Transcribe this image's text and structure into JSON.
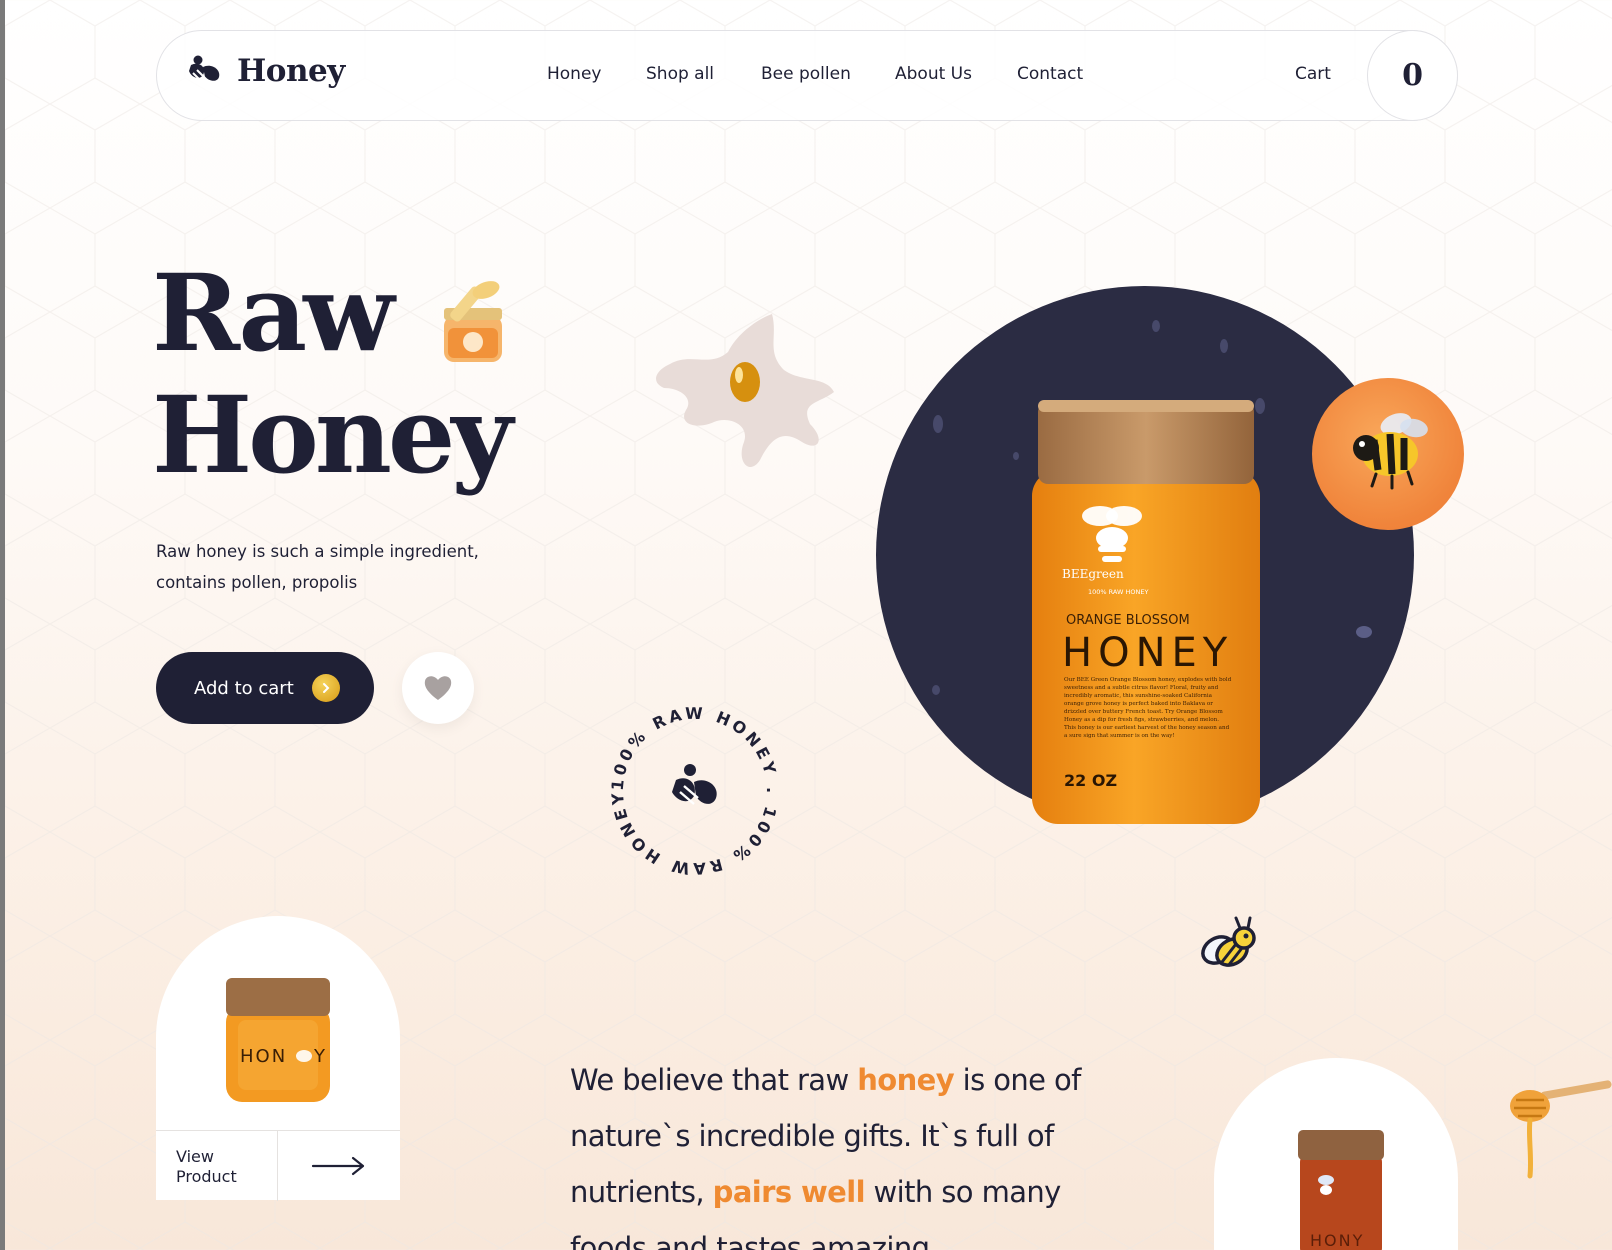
{
  "brand": {
    "name": "Honey",
    "logo_icon": "bee-logo-icon"
  },
  "nav": {
    "links": [
      "Honey",
      "Shop all",
      "Bee pollen",
      "About Us",
      "Contact"
    ],
    "cart_label": "Cart",
    "cart_count": "0"
  },
  "hero": {
    "title_line1": "Raw",
    "title_line2": "Honey",
    "subtitle": "Raw honey is such a simple ingredient, contains pollen, propolis",
    "add_to_cart": "Add to cart",
    "favorite_icon": "heart-icon"
  },
  "product_jar": {
    "brand": "BEEgreen",
    "tagline": "100% RAW HONEY",
    "flavor": "ORANGE BLOSSOM",
    "name": "HONEY",
    "description": "Our BEE Green Orange Blossom honey, explodes with bold sweetness and a subtle citrus flavor! Floral, fruity and incredibly aromatic, this sunshine-soaked California orange grove honey is perfect baked into Baklava or drizzled over buttery French toast. Try Orange Blossom Honey as a dip for fresh figs, strawberries, and melon. This honey is our earliest harvest of the honey season and a sure sign that summer is on the way!",
    "weight": "22 OZ"
  },
  "seal_text": "100% RAW HONEY . 100% RAW HONEY .",
  "card": {
    "view_label_1": "View",
    "view_label_2": "Product",
    "arrow_icon": "arrow-right-icon"
  },
  "statement": {
    "p1": "We believe that raw ",
    "hl1": "honey",
    "p2": " is one of nature`s incredible gifts. It`s full of nutrients, ",
    "hl2": "pairs well",
    "p3": " with so many foods and tastes amazing."
  },
  "colors": {
    "navy": "#1f2035",
    "accent_orange": "#ef8a31",
    "circle_dark": "#2b2c43",
    "honey_amber": "#f39a22"
  }
}
